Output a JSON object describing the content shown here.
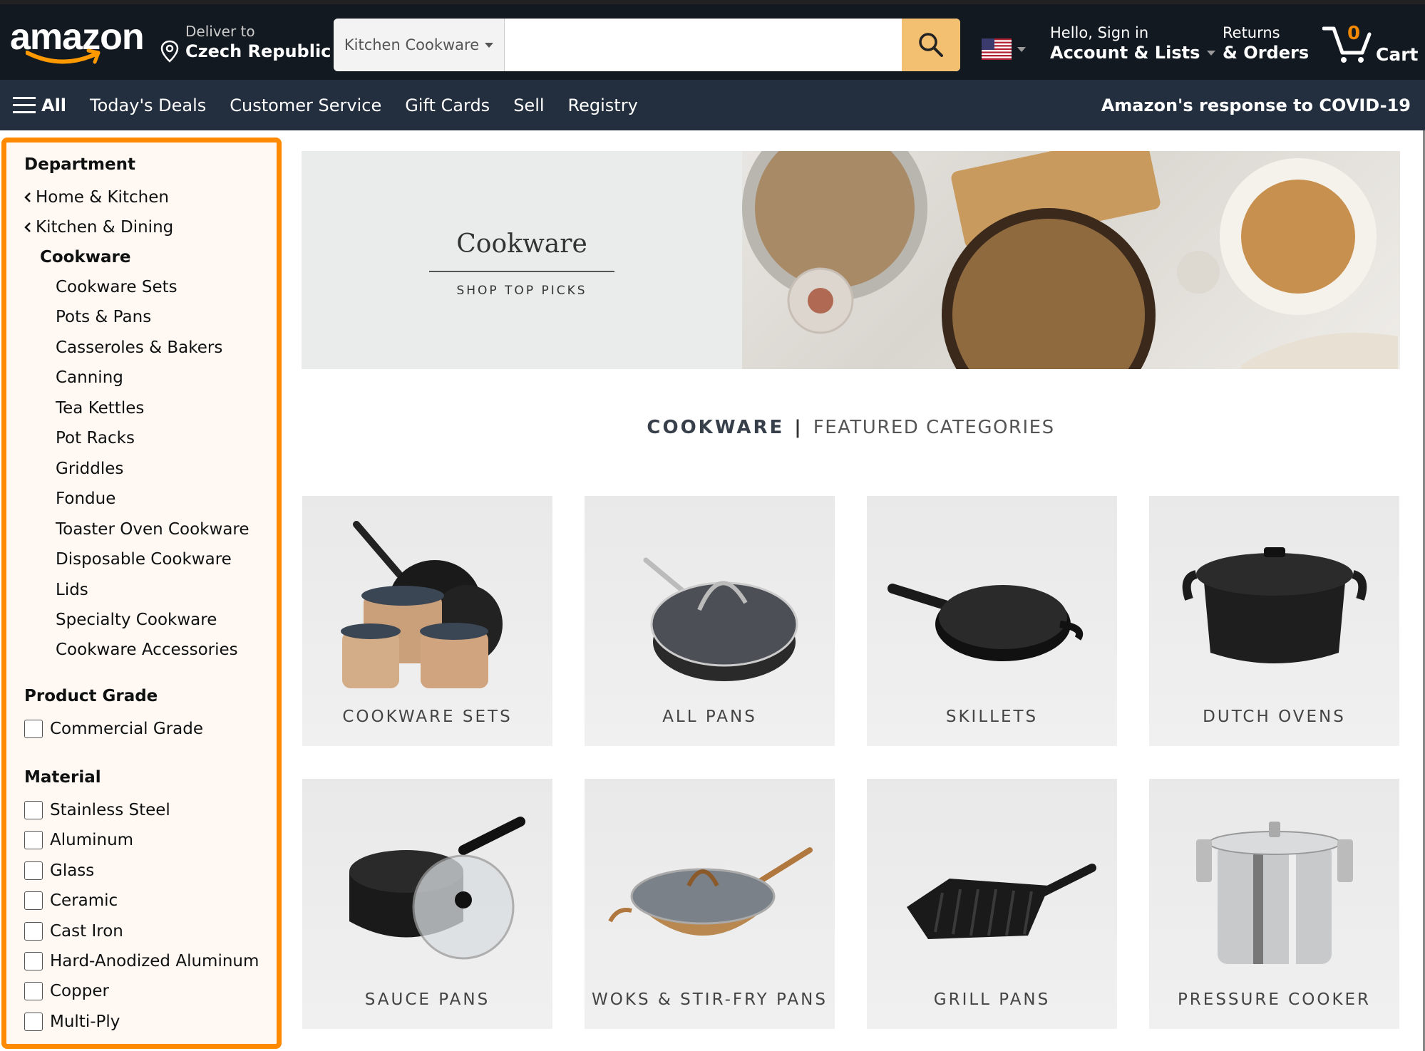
{
  "header": {
    "logo": "amazon",
    "deliver_label": "Deliver to",
    "deliver_location": "Czech Republic",
    "search_category": "Kitchen Cookware",
    "search_value": "",
    "search_placeholder": "",
    "account_greeting": "Hello, Sign in",
    "account_label": "Account & Lists",
    "returns_label": "Returns",
    "orders_label": "& Orders",
    "cart_count": "0",
    "cart_label": "Cart",
    "colors": {
      "topbar": "#131921",
      "navbar": "#232f3e",
      "search_button": "#f3bf71",
      "cart_count": "#f08804"
    }
  },
  "nav": {
    "all_label": "All",
    "items": [
      "Today's Deals",
      "Customer Service",
      "Gift Cards",
      "Sell",
      "Registry"
    ],
    "covid_link": "Amazon's response to COVID-19"
  },
  "sidebar": {
    "highlight_color": "#ff8a00",
    "department_heading": "Department",
    "back_links": [
      "Home & Kitchen",
      "Kitchen & Dining"
    ],
    "current_category": "Cookware",
    "subcategories": [
      "Cookware Sets",
      "Pots & Pans",
      "Casseroles & Bakers",
      "Canning",
      "Tea Kettles",
      "Pot Racks",
      "Griddles",
      "Fondue",
      "Toaster Oven Cookware",
      "Disposable Cookware",
      "Lids",
      "Specialty Cookware",
      "Cookware Accessories"
    ],
    "product_grade_heading": "Product Grade",
    "product_grade_options": [
      {
        "label": "Commercial Grade",
        "checked": false
      }
    ],
    "material_heading": "Material",
    "material_options": [
      {
        "label": "Stainless Steel",
        "checked": false
      },
      {
        "label": "Aluminum",
        "checked": false
      },
      {
        "label": "Glass",
        "checked": false
      },
      {
        "label": "Ceramic",
        "checked": false
      },
      {
        "label": "Cast Iron",
        "checked": false
      },
      {
        "label": "Hard-Anodized Aluminum",
        "checked": false
      },
      {
        "label": "Copper",
        "checked": false
      },
      {
        "label": "Multi-Ply",
        "checked": false
      }
    ]
  },
  "banner": {
    "title": "Cookware",
    "cta": "SHOP TOP PICKS"
  },
  "featured": {
    "heading_main": "COOKWARE",
    "separator": "|",
    "heading_sub": "FEATURED CATEGORIES",
    "cards": [
      {
        "label": "COOKWARE SETS",
        "icon": "cookware-set-image"
      },
      {
        "label": "ALL PANS",
        "icon": "frying-pan-image"
      },
      {
        "label": "SKILLETS",
        "icon": "skillet-image"
      },
      {
        "label": "DUTCH OVENS",
        "icon": "dutch-oven-image"
      },
      {
        "label": "SAUCE PANS",
        "icon": "sauce-pan-image"
      },
      {
        "label": "WOKS & STIR-FRY PANS",
        "icon": "wok-image"
      },
      {
        "label": "GRILL PANS",
        "icon": "grill-pan-image"
      },
      {
        "label": "PRESSURE COOKER",
        "icon": "pressure-cooker-image"
      }
    ]
  }
}
